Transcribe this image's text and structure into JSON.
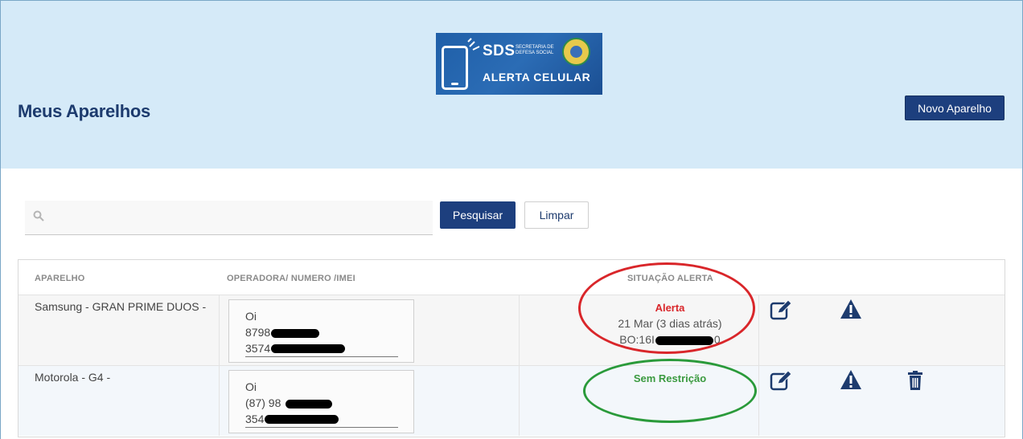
{
  "logo": {
    "brand": "SDS",
    "secretaria": "Secretaria de Defesa Social",
    "product": "ALERTA CELULAR"
  },
  "header": {
    "title": "Meus Aparelhos",
    "new_device_label": "Novo Aparelho"
  },
  "search": {
    "placeholder": "",
    "value": "",
    "search_label": "Pesquisar",
    "clear_label": "Limpar"
  },
  "table": {
    "columns": [
      "APARELHO",
      "OPERADORA/ NUMERO /IMEI",
      "SITUAÇÃO ALERTA"
    ],
    "rows": [
      {
        "device": "Samsung - GRAN PRIME DUOS -",
        "operator": "Oi",
        "number": "8798",
        "imei": "3574",
        "status_label": "Alerta",
        "status_color": "#d9262a",
        "status_date": "21 Mar (3 dias atrás)",
        "status_bo": "BO:16I",
        "status_bo_end": "0",
        "circle_color": "#d9262a"
      },
      {
        "device": "Motorola - G4 -",
        "operator": "Oi",
        "number": "(87) 98",
        "imei": "354",
        "status_label": "Sem Restrição",
        "status_color": "#3a9a3f",
        "circle_color": "#2a9a3a"
      }
    ]
  },
  "colors": {
    "header_bg": "#d5eaf8",
    "primary": "#1d3f7e",
    "icon": "#1d3b6e"
  },
  "icons": [
    "search-icon",
    "edit-icon",
    "warning-icon",
    "trash-icon"
  ]
}
